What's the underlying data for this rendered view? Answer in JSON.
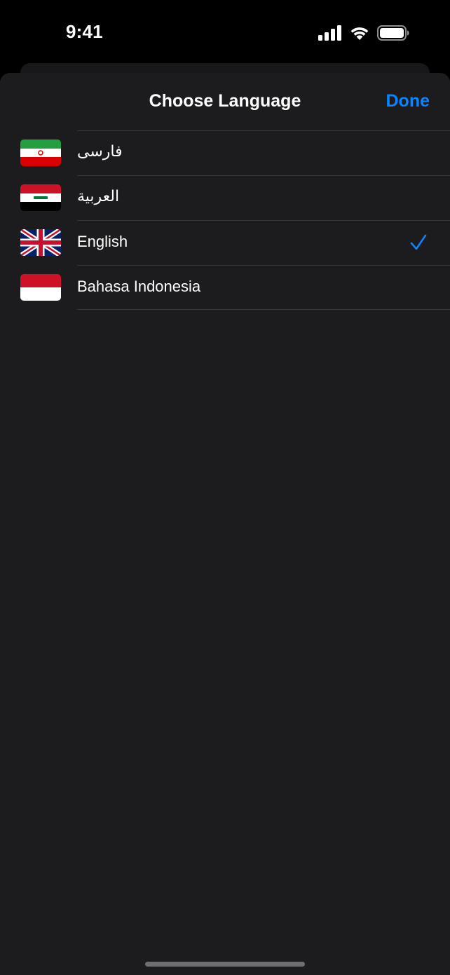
{
  "status_bar": {
    "time": "9:41",
    "icons": [
      "cellular-signal-icon",
      "wifi-icon",
      "battery-icon"
    ]
  },
  "sheet": {
    "title": "Choose Language",
    "done_label": "Done"
  },
  "languages": [
    {
      "label": "فارسی",
      "flag": "iran-flag-icon",
      "selected": false
    },
    {
      "label": "العربية",
      "flag": "iraq-flag-icon",
      "selected": false
    },
    {
      "label": "English",
      "flag": "uk-flag-icon",
      "selected": true
    },
    {
      "label": "Bahasa Indonesia",
      "flag": "indonesia-flag-icon",
      "selected": false
    }
  ],
  "colors": {
    "accent": "#0a84ff",
    "sheet_background": "#1c1c1e",
    "separator": "#38383a",
    "text": "#ffffff"
  }
}
